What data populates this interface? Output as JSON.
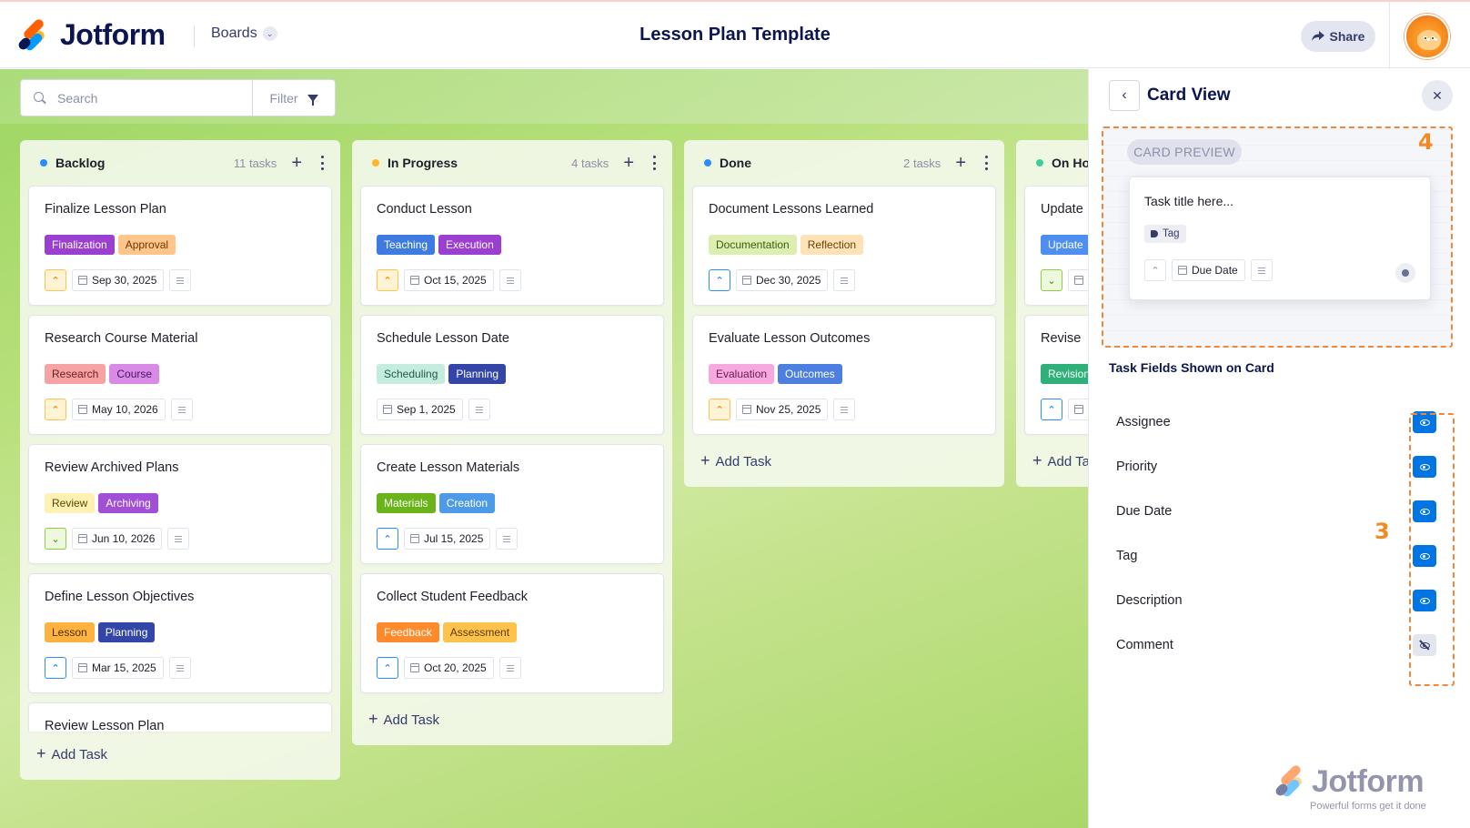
{
  "header": {
    "logo_text": "Jotform",
    "boards_label": "Boards",
    "page_title": "Lesson Plan Template",
    "share_label": "Share"
  },
  "toolbar": {
    "search_placeholder": "Search",
    "filter_label": "Filter"
  },
  "columns": [
    {
      "title": "Backlog",
      "count": "11 tasks",
      "dot_color": "#2d8cff",
      "tasks": [
        {
          "title": "Finalize Lesson Plan",
          "tags": [
            {
              "label": "Finalization",
              "bg": "#9b3fd0",
              "fg": "#ffffff"
            },
            {
              "label": "Approval",
              "bg": "#ffc58a",
              "fg": "#6a3a00"
            }
          ],
          "priority": "high",
          "date": "Sep 30, 2025"
        },
        {
          "title": "Research Course Material",
          "tags": [
            {
              "label": "Research",
              "bg": "#f7a3a3",
              "fg": "#6b1f1f"
            },
            {
              "label": "Course",
              "bg": "#d88ae6",
              "fg": "#4a1160"
            }
          ],
          "priority": "high",
          "date": "May 10, 2026"
        },
        {
          "title": "Review Archived Plans",
          "tags": [
            {
              "label": "Review",
              "bg": "#fff0b3",
              "fg": "#5a4a00"
            },
            {
              "label": "Archiving",
              "bg": "#a04fd6",
              "fg": "#ffffff"
            }
          ],
          "priority": "low",
          "date": "Jun 10, 2026"
        },
        {
          "title": "Define Lesson Objectives",
          "tags": [
            {
              "label": "Lesson",
              "bg": "#ffb23e",
              "fg": "#4d2e00"
            },
            {
              "label": "Planning",
              "bg": "#3346a8",
              "fg": "#ffffff"
            }
          ],
          "priority": "medium",
          "date": "Mar 15, 2025"
        }
      ],
      "partial_task": "Review Lesson Plan",
      "add_label": "Add Task"
    },
    {
      "title": "In Progress",
      "count": "4 tasks",
      "dot_color": "#ffb629",
      "tasks": [
        {
          "title": "Conduct Lesson",
          "tags": [
            {
              "label": "Teaching",
              "bg": "#3d7be0",
              "fg": "#ffffff"
            },
            {
              "label": "Execution",
              "bg": "#9b3fd0",
              "fg": "#ffffff"
            }
          ],
          "priority": "high",
          "date": "Oct 15, 2025"
        },
        {
          "title": "Schedule Lesson Date",
          "tags": [
            {
              "label": "Scheduling",
              "bg": "#c4ede0",
              "fg": "#1f5a48"
            },
            {
              "label": "Planning",
              "bg": "#3346a8",
              "fg": "#ffffff"
            }
          ],
          "priority": "none",
          "date": "Sep 1, 2025"
        },
        {
          "title": "Create Lesson Materials",
          "tags": [
            {
              "label": "Materials",
              "bg": "#6ab41a",
              "fg": "#ffffff"
            },
            {
              "label": "Creation",
              "bg": "#4d9be8",
              "fg": "#ffffff"
            }
          ],
          "priority": "medium",
          "date": "Jul 15, 2025"
        },
        {
          "title": "Collect Student Feedback",
          "tags": [
            {
              "label": "Feedback",
              "bg": "#ff8a2b",
              "fg": "#ffffff"
            },
            {
              "label": "Assessment",
              "bg": "#ffc24d",
              "fg": "#5a3a00"
            }
          ],
          "priority": "medium",
          "date": "Oct 20, 2025"
        }
      ],
      "add_label": "Add Task"
    },
    {
      "title": "Done",
      "count": "2 tasks",
      "dot_color": "#2d8cff",
      "tasks": [
        {
          "title": "Document Lessons Learned",
          "tags": [
            {
              "label": "Documentation",
              "bg": "#dcefb0",
              "fg": "#3f5a10"
            },
            {
              "label": "Reflection",
              "bg": "#ffe2b8",
              "fg": "#6a4300"
            }
          ],
          "priority": "medium",
          "date": "Dec 30, 2025"
        },
        {
          "title": "Evaluate Lesson Outcomes",
          "tags": [
            {
              "label": "Evaluation",
              "bg": "#f7a8dc",
              "fg": "#6b1a52"
            },
            {
              "label": "Outcomes",
              "bg": "#4d7fe0",
              "fg": "#ffffff"
            }
          ],
          "priority": "high",
          "date": "Nov 25, 2025"
        }
      ],
      "add_label": "Add Task"
    },
    {
      "title": "On Hold",
      "count": "",
      "dot_color": "#3ccf9a",
      "tasks": [
        {
          "title": "Update",
          "tags": [
            {
              "label": "Update",
              "bg": "#4d8ef0",
              "fg": "#ffffff"
            }
          ],
          "priority": "low",
          "date": ""
        },
        {
          "title": "Revise",
          "tags": [
            {
              "label": "Revision",
              "bg": "#2fb07a",
              "fg": "#ffffff"
            }
          ],
          "priority": "medium",
          "date": ""
        }
      ],
      "add_label": "Add Task"
    }
  ],
  "panel": {
    "title": "Card View",
    "preview_label": "CARD PREVIEW",
    "preview_card_title": "Task title here...",
    "preview_tag": "Tag",
    "preview_due": "Due Date",
    "fields_title": "Task Fields Shown on Card",
    "fields": [
      {
        "label": "Assignee",
        "visible": true
      },
      {
        "label": "Priority",
        "visible": true
      },
      {
        "label": "Due Date",
        "visible": true
      },
      {
        "label": "Tag",
        "visible": true
      },
      {
        "label": "Description",
        "visible": true
      },
      {
        "label": "Comment",
        "visible": false
      }
    ],
    "annotation_preview": "4",
    "annotation_fields": "3",
    "watermark": "Jotform",
    "watermark_sub": "Powerful forms get it done"
  }
}
